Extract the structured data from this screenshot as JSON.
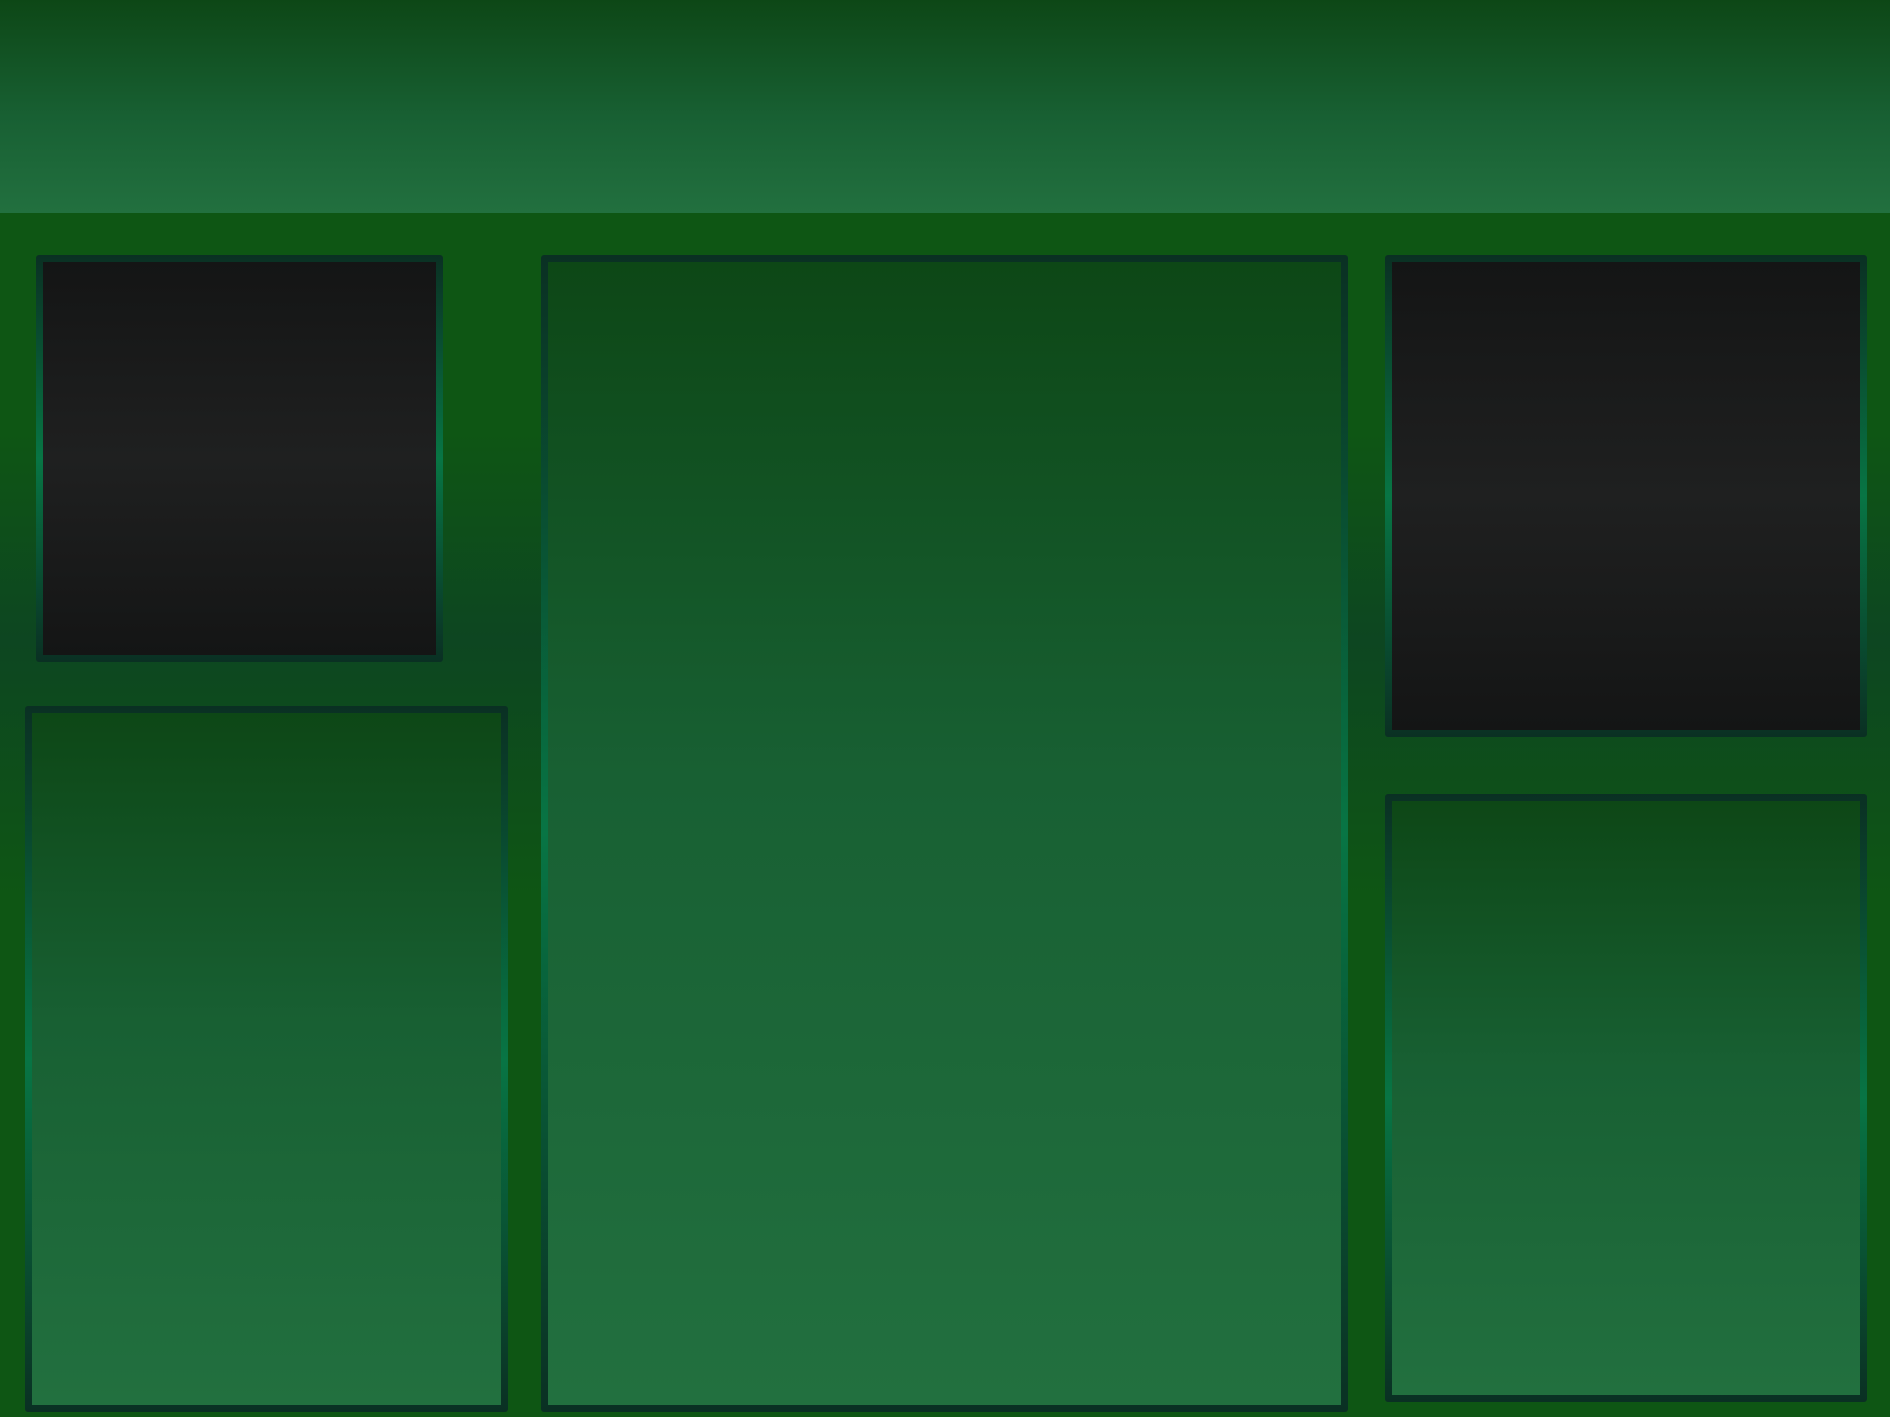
{
  "header": {
    "title": ""
  },
  "panels": [
    {
      "id": "panel-a",
      "variant": "dark"
    },
    {
      "id": "panel-b",
      "variant": "green"
    },
    {
      "id": "panel-c",
      "variant": "green"
    },
    {
      "id": "panel-d",
      "variant": "dark"
    },
    {
      "id": "panel-e",
      "variant": "green"
    }
  ],
  "colors": {
    "background": "#0e5614",
    "header_top": "#0d4716",
    "header_bottom": "#22703f",
    "dark_panel": "#1f2020",
    "panel_border": "#087544"
  }
}
